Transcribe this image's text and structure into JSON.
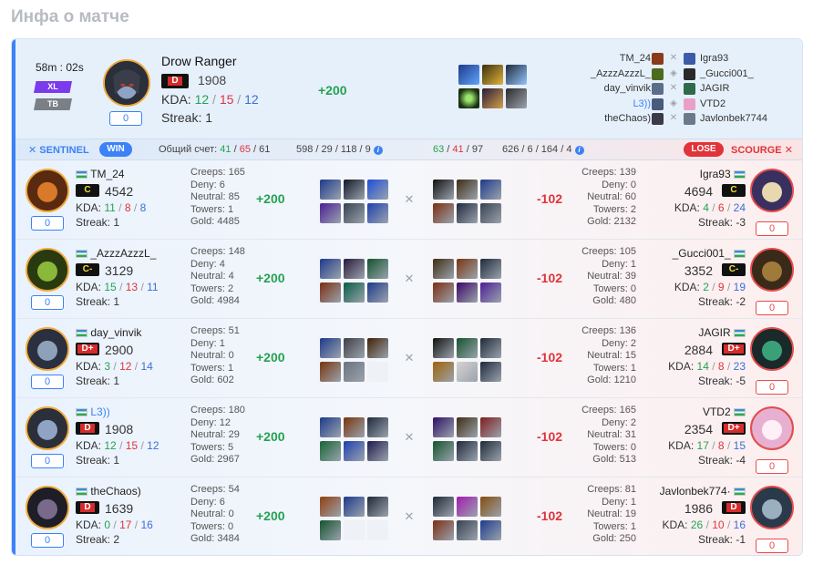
{
  "page": {
    "title": "Инфа о матче"
  },
  "top": {
    "duration": "58m : 02s",
    "mode1": "XL",
    "mode2": "TB",
    "hero_name": "Drow Ranger",
    "rank": "D",
    "mmr": "1908",
    "kda_label": "KDA:",
    "kills": "12",
    "deaths": "15",
    "assists": "12",
    "streak": "Streak: 1",
    "zero": "0",
    "diff": "+200",
    "left_players": [
      "TM_24",
      "_AzzzAzzzL_",
      "day_vinvik",
      "L3))",
      "theChaos)"
    ],
    "right_players": [
      "Igra93",
      "_Gucci001_",
      "JAGIR",
      "VTD2",
      "Javlonbek7744"
    ]
  },
  "summary": {
    "sentinel": "SENTINEL",
    "win": "WIN",
    "total_label": "Общий счет:",
    "s_k": "41",
    "s_d": "65",
    "s_a": "61",
    "s_rest": "598 / 29 / 118 / 9",
    "c_k": "63",
    "c_d": "41",
    "c_a": "97",
    "c_rest": "626 / 6 / 164 / 4",
    "lose": "LOSE",
    "scourge": "SCOURGE"
  },
  "labels": {
    "kda": "KDA:",
    "sep": "/"
  },
  "rows": [
    {
      "left": {
        "name": "TM_24",
        "rank": "C",
        "mmr": "4542",
        "k": "11",
        "d": "8",
        "a": "8",
        "streak": "Streak: 1",
        "zero": "0",
        "creeps": "Creeps: 165",
        "deny": "Deny: 6",
        "neutral": "Neutral: 85",
        "towers": "Towers: 1",
        "gold": "Gold: 4485",
        "diff": "+200"
      },
      "right": {
        "name": "Igra93",
        "rank": "C",
        "mmr": "4694",
        "k": "4",
        "d": "6",
        "a": "24",
        "streak": "Streak: -3",
        "zero": "0",
        "creeps": "Creeps: 139",
        "deny": "Deny: 0",
        "neutral": "Neutral: 60",
        "towers": "Towers: 2",
        "gold": "Gold: 2132",
        "diff": "-102"
      }
    },
    {
      "left": {
        "name": "_AzzzAzzzL_",
        "rank": "C-",
        "mmr": "3129",
        "k": "15",
        "d": "13",
        "a": "11",
        "streak": "Streak: 1",
        "zero": "0",
        "creeps": "Creeps: 148",
        "deny": "Deny: 4",
        "neutral": "Neutral: 4",
        "towers": "Towers: 2",
        "gold": "Gold: 4984",
        "diff": "+200"
      },
      "right": {
        "name": "_Gucci001_",
        "rank": "C-",
        "mmr": "3352",
        "k": "2",
        "d": "9",
        "a": "19",
        "streak": "Streak: -2",
        "zero": "0",
        "creeps": "Creeps: 105",
        "deny": "Deny: 1",
        "neutral": "Neutral: 39",
        "towers": "Towers: 0",
        "gold": "Gold: 480",
        "diff": "-102"
      }
    },
    {
      "left": {
        "name": "day_vinvik",
        "rank": "D+",
        "mmr": "2900",
        "k": "3",
        "d": "12",
        "a": "14",
        "streak": "Streak: 1",
        "zero": "0",
        "creeps": "Creeps: 51",
        "deny": "Deny: 1",
        "neutral": "Neutral: 0",
        "towers": "Towers: 1",
        "gold": "Gold: 602",
        "diff": "+200"
      },
      "right": {
        "name": "JAGIR",
        "rank": "D+",
        "mmr": "2884",
        "k": "14",
        "d": "8",
        "a": "23",
        "streak": "Streak: -5",
        "zero": "0",
        "creeps": "Creeps: 136",
        "deny": "Deny: 2",
        "neutral": "Neutral: 15",
        "towers": "Towers: 1",
        "gold": "Gold: 1210",
        "diff": "-102"
      }
    },
    {
      "left": {
        "name": "L3))",
        "rank": "D",
        "mmr": "1908",
        "k": "12",
        "d": "15",
        "a": "12",
        "streak": "Streak: 1",
        "zero": "0",
        "creeps": "Creeps: 180",
        "deny": "Deny: 12",
        "neutral": "Neutral: 29",
        "towers": "Towers: 5",
        "gold": "Gold: 2967",
        "diff": "+200"
      },
      "right": {
        "name": "VTD2",
        "rank": "D+",
        "mmr": "2354",
        "k": "17",
        "d": "8",
        "a": "15",
        "streak": "Streak: -4",
        "zero": "0",
        "creeps": "Creeps: 165",
        "deny": "Deny: 2",
        "neutral": "Neutral: 31",
        "towers": "Towers: 0",
        "gold": "Gold: 513",
        "diff": "-102"
      }
    },
    {
      "left": {
        "name": "theChaos)",
        "rank": "D",
        "mmr": "1639",
        "k": "0",
        "d": "17",
        "a": "16",
        "streak": "Streak: 2",
        "zero": "0",
        "creeps": "Creeps: 54",
        "deny": "Deny: 6",
        "neutral": "Neutral: 0",
        "towers": "Towers: 0",
        "gold": "Gold: 3484",
        "diff": "+200"
      },
      "right": {
        "name": "Javlonbek774·",
        "rank": "D",
        "mmr": "1986",
        "k": "26",
        "d": "10",
        "a": "16",
        "streak": "Streak: -1",
        "zero": "0",
        "creeps": "Creeps: 81",
        "deny": "Deny: 1",
        "neutral": "Neutral: 19",
        "towers": "Towers: 1",
        "gold": "Gold: 250",
        "diff": "-102"
      }
    }
  ],
  "colors": {
    "accent": "#3b82f6",
    "win": "#22a352",
    "lose": "#e0333a",
    "mode_xl": "#7c3aed"
  }
}
